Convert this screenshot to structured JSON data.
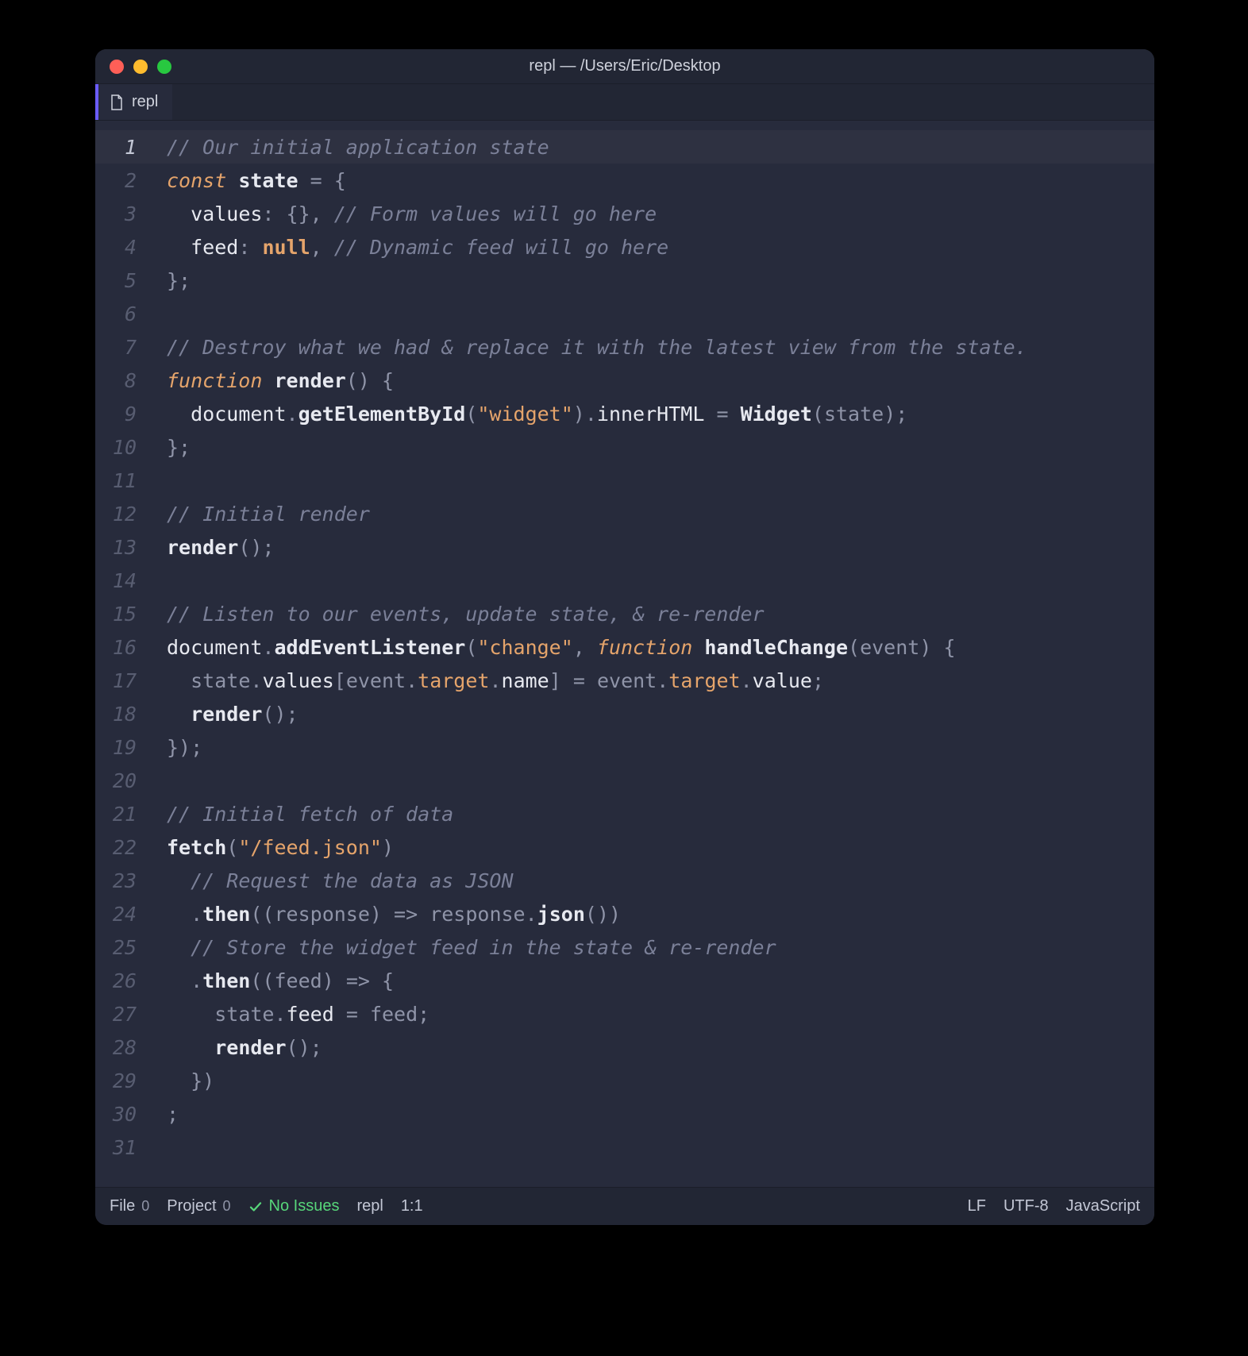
{
  "titlebar": {
    "title": "repl — /Users/Eric/Desktop"
  },
  "tab": {
    "label": "repl"
  },
  "code": {
    "lines": [
      {
        "num": "1",
        "current": true,
        "tokens": [
          {
            "c": "tok-cm",
            "t": "// Our initial application state"
          }
        ]
      },
      {
        "num": "2",
        "tokens": [
          {
            "c": "tok-kw",
            "t": "const"
          },
          {
            "c": "tok-pn",
            "t": " "
          },
          {
            "c": "tok-def",
            "t": "state"
          },
          {
            "c": "tok-pn",
            "t": " "
          },
          {
            "c": "tok-op",
            "t": "="
          },
          {
            "c": "tok-pn",
            "t": " { "
          }
        ]
      },
      {
        "num": "3",
        "tokens": [
          {
            "c": "tok-pn",
            "t": "  "
          },
          {
            "c": "tok-id",
            "t": "values"
          },
          {
            "c": "tok-pn",
            "t": ": {}, "
          },
          {
            "c": "tok-cm",
            "t": "// Form values will go here"
          }
        ]
      },
      {
        "num": "4",
        "tokens": [
          {
            "c": "tok-pn",
            "t": "  "
          },
          {
            "c": "tok-id",
            "t": "feed"
          },
          {
            "c": "tok-pn",
            "t": ": "
          },
          {
            "c": "tok-nul",
            "t": "null"
          },
          {
            "c": "tok-pn",
            "t": ", "
          },
          {
            "c": "tok-cm",
            "t": "// Dynamic feed will go here"
          }
        ]
      },
      {
        "num": "5",
        "tokens": [
          {
            "c": "tok-pn",
            "t": "};"
          }
        ]
      },
      {
        "num": "6",
        "tokens": [
          {
            "c": "tok-pn",
            "t": ""
          }
        ]
      },
      {
        "num": "7",
        "tokens": [
          {
            "c": "tok-cm",
            "t": "// Destroy what we had & replace it with the latest view from the state."
          }
        ]
      },
      {
        "num": "8",
        "tokens": [
          {
            "c": "tok-kw",
            "t": "function"
          },
          {
            "c": "tok-pn",
            "t": " "
          },
          {
            "c": "tok-def",
            "t": "render"
          },
          {
            "c": "tok-pn",
            "t": "() {"
          }
        ]
      },
      {
        "num": "9",
        "tokens": [
          {
            "c": "tok-pn",
            "t": "  "
          },
          {
            "c": "tok-builtin",
            "t": "document"
          },
          {
            "c": "tok-pn",
            "t": "."
          },
          {
            "c": "tok-call",
            "t": "getElementById"
          },
          {
            "c": "tok-pn",
            "t": "("
          },
          {
            "c": "tok-str",
            "t": "\"widget\""
          },
          {
            "c": "tok-pn",
            "t": ")."
          },
          {
            "c": "tok-id",
            "t": "innerHTML"
          },
          {
            "c": "tok-pn",
            "t": " "
          },
          {
            "c": "tok-op",
            "t": "="
          },
          {
            "c": "tok-pn",
            "t": " "
          },
          {
            "c": "tok-call",
            "t": "Widget"
          },
          {
            "c": "tok-pn",
            "t": "("
          },
          {
            "c": "tok-prp",
            "t": "state"
          },
          {
            "c": "tok-pn",
            "t": ");"
          }
        ]
      },
      {
        "num": "10",
        "tokens": [
          {
            "c": "tok-pn",
            "t": "};"
          }
        ]
      },
      {
        "num": "11",
        "tokens": [
          {
            "c": "tok-pn",
            "t": ""
          }
        ]
      },
      {
        "num": "12",
        "tokens": [
          {
            "c": "tok-cm",
            "t": "// Initial render"
          }
        ]
      },
      {
        "num": "13",
        "tokens": [
          {
            "c": "tok-call",
            "t": "render"
          },
          {
            "c": "tok-pn",
            "t": "();"
          }
        ]
      },
      {
        "num": "14",
        "tokens": [
          {
            "c": "tok-pn",
            "t": ""
          }
        ]
      },
      {
        "num": "15",
        "tokens": [
          {
            "c": "tok-cm",
            "t": "// Listen to our events, update state, & re-render"
          }
        ]
      },
      {
        "num": "16",
        "tokens": [
          {
            "c": "tok-builtin",
            "t": "document"
          },
          {
            "c": "tok-pn",
            "t": "."
          },
          {
            "c": "tok-call",
            "t": "addEventListener"
          },
          {
            "c": "tok-pn",
            "t": "("
          },
          {
            "c": "tok-str",
            "t": "\"change\""
          },
          {
            "c": "tok-pn",
            "t": ", "
          },
          {
            "c": "tok-kw",
            "t": "function"
          },
          {
            "c": "tok-pn",
            "t": " "
          },
          {
            "c": "tok-def",
            "t": "handleChange"
          },
          {
            "c": "tok-pn",
            "t": "("
          },
          {
            "c": "tok-prp",
            "t": "event"
          },
          {
            "c": "tok-pn",
            "t": ") {"
          }
        ]
      },
      {
        "num": "17",
        "tokens": [
          {
            "c": "tok-pn",
            "t": "  "
          },
          {
            "c": "tok-prp",
            "t": "state"
          },
          {
            "c": "tok-pn",
            "t": "."
          },
          {
            "c": "tok-id",
            "t": "values"
          },
          {
            "c": "tok-pn",
            "t": "["
          },
          {
            "c": "tok-prp",
            "t": "event"
          },
          {
            "c": "tok-pn",
            "t": "."
          },
          {
            "c": "tok-str",
            "t": "target"
          },
          {
            "c": "tok-pn",
            "t": "."
          },
          {
            "c": "tok-id",
            "t": "name"
          },
          {
            "c": "tok-pn",
            "t": "] "
          },
          {
            "c": "tok-op",
            "t": "="
          },
          {
            "c": "tok-pn",
            "t": " "
          },
          {
            "c": "tok-prp",
            "t": "event"
          },
          {
            "c": "tok-pn",
            "t": "."
          },
          {
            "c": "tok-str",
            "t": "target"
          },
          {
            "c": "tok-pn",
            "t": "."
          },
          {
            "c": "tok-id",
            "t": "value"
          },
          {
            "c": "tok-pn",
            "t": ";"
          }
        ]
      },
      {
        "num": "18",
        "tokens": [
          {
            "c": "tok-pn",
            "t": "  "
          },
          {
            "c": "tok-call",
            "t": "render"
          },
          {
            "c": "tok-pn",
            "t": "();"
          }
        ]
      },
      {
        "num": "19",
        "tokens": [
          {
            "c": "tok-pn",
            "t": "});"
          }
        ]
      },
      {
        "num": "20",
        "tokens": [
          {
            "c": "tok-pn",
            "t": ""
          }
        ]
      },
      {
        "num": "21",
        "tokens": [
          {
            "c": "tok-cm",
            "t": "// Initial fetch of data"
          }
        ]
      },
      {
        "num": "22",
        "tokens": [
          {
            "c": "tok-call",
            "t": "fetch"
          },
          {
            "c": "tok-pn",
            "t": "("
          },
          {
            "c": "tok-str",
            "t": "\"/feed.json\""
          },
          {
            "c": "tok-pn",
            "t": ")"
          }
        ]
      },
      {
        "num": "23",
        "tokens": [
          {
            "c": "tok-pn",
            "t": "  "
          },
          {
            "c": "tok-cm",
            "t": "// Request the data as JSON"
          }
        ]
      },
      {
        "num": "24",
        "tokens": [
          {
            "c": "tok-pn",
            "t": "  ."
          },
          {
            "c": "tok-call",
            "t": "then"
          },
          {
            "c": "tok-pn",
            "t": "(("
          },
          {
            "c": "tok-prp",
            "t": "response"
          },
          {
            "c": "tok-pn",
            "t": ") "
          },
          {
            "c": "tok-op",
            "t": "=>"
          },
          {
            "c": "tok-pn",
            "t": " "
          },
          {
            "c": "tok-prp",
            "t": "response"
          },
          {
            "c": "tok-pn",
            "t": "."
          },
          {
            "c": "tok-call",
            "t": "json"
          },
          {
            "c": "tok-pn",
            "t": "())"
          }
        ]
      },
      {
        "num": "25",
        "tokens": [
          {
            "c": "tok-pn",
            "t": "  "
          },
          {
            "c": "tok-cm",
            "t": "// Store the widget feed in the state & re-render"
          }
        ]
      },
      {
        "num": "26",
        "tokens": [
          {
            "c": "tok-pn",
            "t": "  ."
          },
          {
            "c": "tok-call",
            "t": "then"
          },
          {
            "c": "tok-pn",
            "t": "(("
          },
          {
            "c": "tok-prp",
            "t": "feed"
          },
          {
            "c": "tok-pn",
            "t": ") "
          },
          {
            "c": "tok-op",
            "t": "=>"
          },
          {
            "c": "tok-pn",
            "t": " {"
          }
        ]
      },
      {
        "num": "27",
        "tokens": [
          {
            "c": "tok-pn",
            "t": "    "
          },
          {
            "c": "tok-prp",
            "t": "state"
          },
          {
            "c": "tok-pn",
            "t": "."
          },
          {
            "c": "tok-id",
            "t": "feed"
          },
          {
            "c": "tok-pn",
            "t": " "
          },
          {
            "c": "tok-op",
            "t": "="
          },
          {
            "c": "tok-pn",
            "t": " "
          },
          {
            "c": "tok-prp",
            "t": "feed"
          },
          {
            "c": "tok-pn",
            "t": ";"
          }
        ]
      },
      {
        "num": "28",
        "tokens": [
          {
            "c": "tok-pn",
            "t": "    "
          },
          {
            "c": "tok-call",
            "t": "render"
          },
          {
            "c": "tok-pn",
            "t": "();"
          }
        ]
      },
      {
        "num": "29",
        "tokens": [
          {
            "c": "tok-pn",
            "t": "  })"
          }
        ]
      },
      {
        "num": "30",
        "tokens": [
          {
            "c": "tok-pn",
            "t": ";"
          }
        ]
      },
      {
        "num": "31",
        "tokens": [
          {
            "c": "tok-pn",
            "t": ""
          }
        ]
      }
    ]
  },
  "statusbar": {
    "file_label": "File",
    "file_count": "0",
    "project_label": "Project",
    "project_count": "0",
    "issues_label": "No Issues",
    "filename": "repl",
    "cursor": "1:1",
    "line_ending": "LF",
    "encoding": "UTF-8",
    "language": "JavaScript"
  }
}
